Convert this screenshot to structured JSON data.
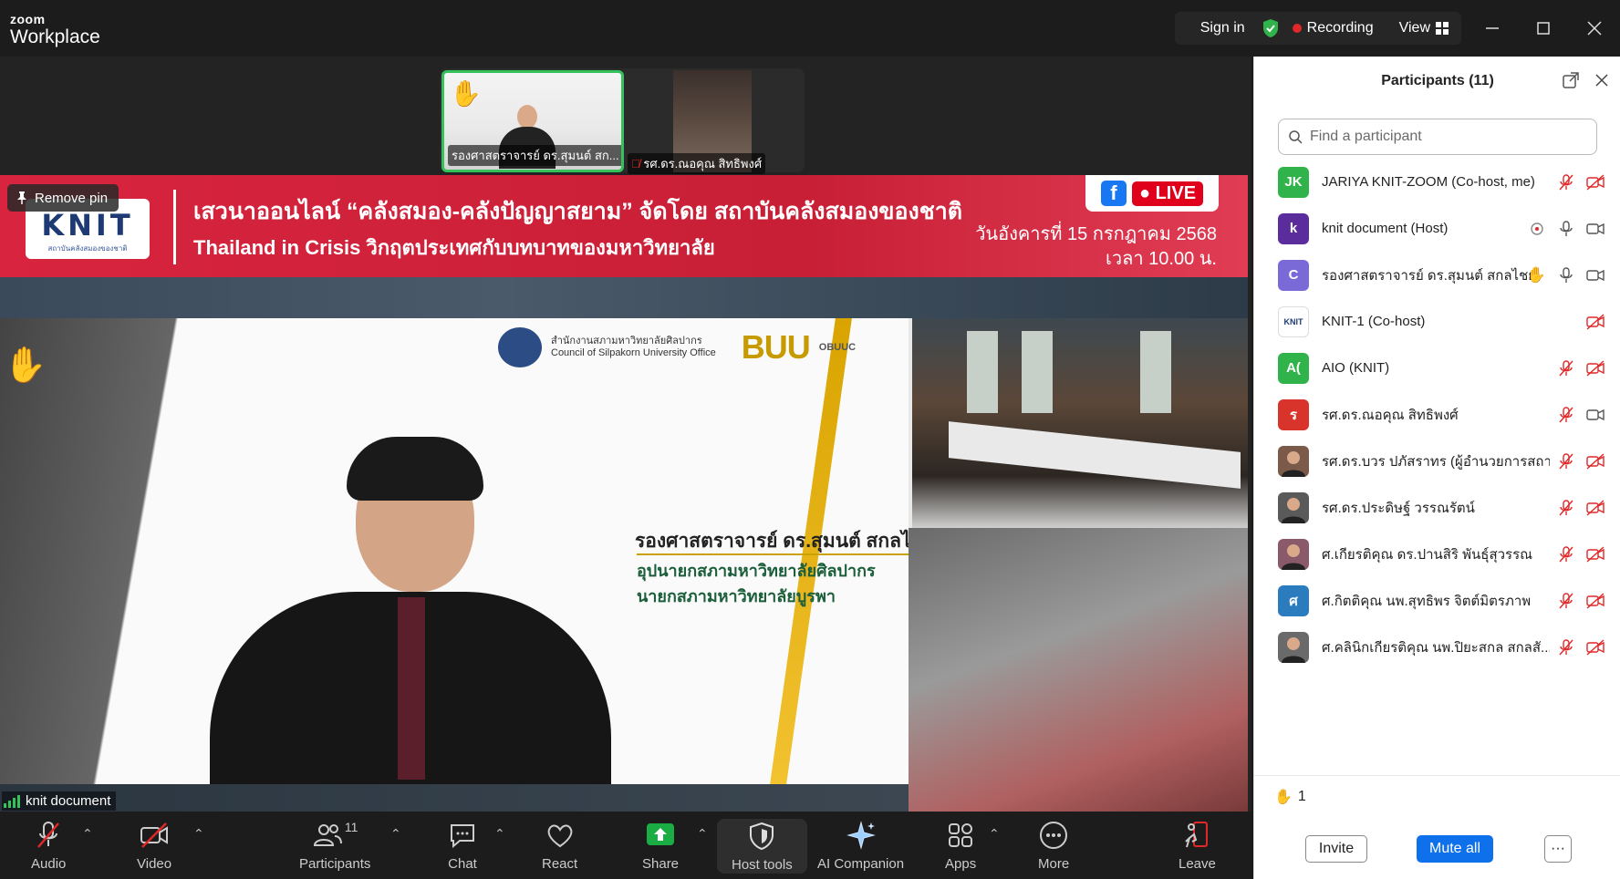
{
  "app": {
    "logo_top": "zoom",
    "logo_bottom": "Workplace"
  },
  "titlebar": {
    "sign_in": "Sign in",
    "recording": "Recording",
    "view": "View",
    "minimize_icon": "minimize-icon",
    "maximize_icon": "maximize-icon",
    "close_icon": "close-icon"
  },
  "thumbnails": [
    {
      "name": "รองศาสตราจารย์ ดร.สุมนต์ สก...",
      "raised_hand": true,
      "active_speaker": true
    },
    {
      "name": "รศ.ดร.ณอคุณ  สิทธิพงศ์",
      "muted": true
    }
  ],
  "content": {
    "remove_pin": "Remove pin",
    "banner_logo": "KNIT",
    "banner_logo_sub": "สถาบันคลังสมองของชาติ",
    "banner_line1": "เสวนาออนไลน์ “คลังสมอง-คลังปัญญาสยาม” จัดโดย สถาบันคลังสมองของชาติ",
    "banner_line2": "Thailand in Crisis  วิกฤตประเทศกับบทบาทของมหาวิทยาลัย",
    "live": "LIVE",
    "fb": "f",
    "date_line1": "วันอังคารที่ 15 กรกฎาคม 2568",
    "date_line2": "เวลา 10.00 น.",
    "slide_org": "สำนักงานสภามหาวิทยาลัยศิลปากร",
    "slide_org_en": "Council of Silpakorn University Office",
    "slide_buu": "BUU",
    "slide_obuuc": "OBUUC",
    "speaker_name": "รองศาสตราจารย์ ดร.สุมนต์ สกลไชย",
    "speaker_role1": "อุปนายกสภามหาวิทยาลัยศิลปากร",
    "speaker_role2": "นายกสภามหาวิทยาลัยบูรพา",
    "name_tag": "knit document"
  },
  "toolbar": {
    "audio": "Audio",
    "video": "Video",
    "participants": "Participants",
    "participants_count": "11",
    "chat": "Chat",
    "react": "React",
    "share": "Share",
    "host_tools": "Host tools",
    "ai_companion": "AI Companion",
    "apps": "Apps",
    "more": "More",
    "leave": "Leave"
  },
  "panel": {
    "title": "Participants (11)",
    "search_placeholder": "Find a participant",
    "participants": [
      {
        "initials": "JK",
        "color": "#2fb34a",
        "name": "JARIYA KNIT-ZOOM (Co-host, me)",
        "mic": "muted",
        "video": "off"
      },
      {
        "initials": "k",
        "color": "#5b2d9c",
        "name": "knit document (Host)",
        "mic": "on",
        "video": "on",
        "screen": true
      },
      {
        "initials": "C",
        "color": "#7a6ad8",
        "name": "รองศาสตราจารย์ ดร.สุมนต์ สกลไชย",
        "mic": "on",
        "video": "on",
        "hand": true
      },
      {
        "initials": "KNIT",
        "color": "#ffffff",
        "name": "KNIT-1 (Co-host)",
        "video": "off",
        "logo": true
      },
      {
        "initials": "A(",
        "color": "#2fb34a",
        "name": "AIO (KNIT)",
        "mic": "muted",
        "video": "off"
      },
      {
        "initials": "ร",
        "color": "#d9342b",
        "name": "รศ.ดร.ณอคุณ  สิทธิพงศ์",
        "mic": "muted",
        "video": "on"
      },
      {
        "initials": "",
        "color": "#7b5a4a",
        "name": "รศ.ดร.บวร  ปภัสราทร (ผู้อำนวยการสถา...",
        "mic": "muted",
        "video": "off",
        "photo": true
      },
      {
        "initials": "",
        "color": "#5a5a5a",
        "name": "รศ.ดร.ประดิษฐ์  วรรณรัตน์",
        "mic": "muted",
        "video": "off",
        "photo": true
      },
      {
        "initials": "",
        "color": "#8a5a6a",
        "name": "ศ.เกียรติคุณ ดร.ปานสิริ  พันธุ์สุวรรณ",
        "mic": "muted",
        "video": "off",
        "photo": true
      },
      {
        "initials": "ศ",
        "color": "#2b7bbf",
        "name": "ศ.กิตติคุณ นพ.สุทธิพร  จิตต์มิตรภาพ",
        "mic": "muted",
        "video": "off"
      },
      {
        "initials": "",
        "color": "#6a6a6a",
        "name": "ศ.คลินิกเกียรติคุณ นพ.ปิยะสกล  สกลสั...",
        "mic": "muted",
        "video": "off",
        "photo": true
      }
    ],
    "raised_hands": "1",
    "invite": "Invite",
    "mute_all": "Mute all",
    "more": "···"
  }
}
